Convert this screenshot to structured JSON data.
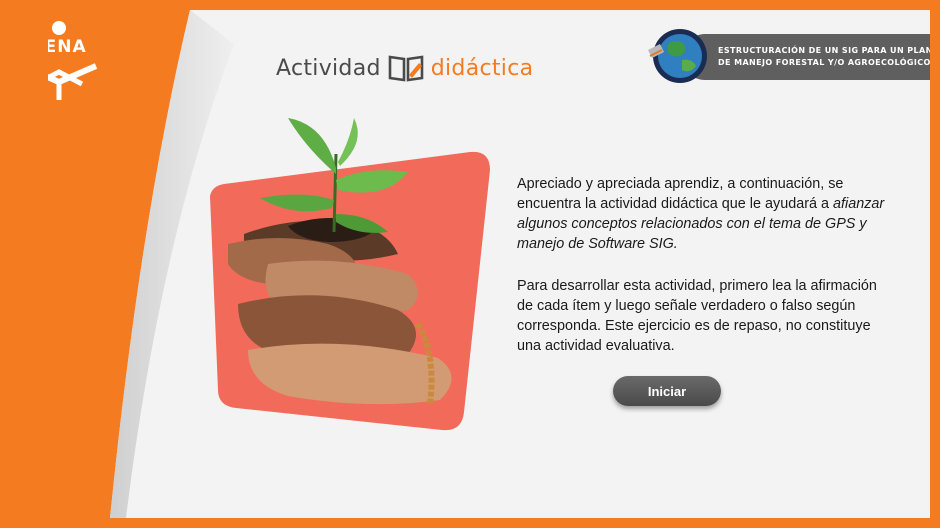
{
  "brand": {
    "logo_text": "SENA",
    "activity_word1": "Actividad",
    "activity_word2": "didáctica",
    "accent_color": "#f47b20"
  },
  "course": {
    "title_line1": "ESTRUCTURACIÓN DE UN SIG PARA UN PLAN",
    "title_line2": "DE MANEJO FORESTAL Y/O AGROECOLÓGICO",
    "icon": "globe-satellite-icon"
  },
  "intro": {
    "p1_normal": "Apreciado y apreciada aprendiz, a continuación, se encuentra la actividad didáctica que le ayudará a ",
    "p1_italic": "afianzar algunos conceptos relacionados con el tema de GPS y manejo de Software SIG.",
    "p2": "Para desarrollar esta actividad, primero lea la afirmación de cada ítem y luego señale verdadero o falso según corresponda. Este ejercicio es de repaso, no constituye una actividad evaluativa."
  },
  "actions": {
    "start_label": "Iniciar"
  }
}
